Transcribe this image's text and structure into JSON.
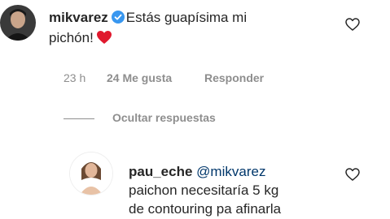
{
  "comment": {
    "username": "mikvarez",
    "text_line1": "Estás guapísima mi",
    "text_line2": "pichón!",
    "time": "23 h",
    "likes": "24 Me gusta",
    "reply_label": "Responder"
  },
  "thread": {
    "hide_replies_label": "Ocultar respuestas"
  },
  "reply": {
    "username": "pau_eche",
    "mention": "@mikvarez",
    "text_line1": "paichon necesitaría 5 kg",
    "text_line2": "de contouring pa afinarla"
  },
  "icons": {
    "like": "heart-outline-icon",
    "verified": "verified-badge-icon",
    "emoji": "red-heart-emoji"
  },
  "colors": {
    "verified": "#3897f0",
    "heart_emoji": "#e0182d",
    "meta_text": "#8e8e8e",
    "mention": "#00376b"
  }
}
